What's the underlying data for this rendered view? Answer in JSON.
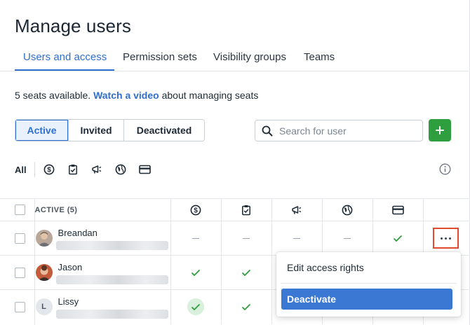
{
  "page": {
    "title": "Manage users"
  },
  "tabs": [
    {
      "label": "Users and access",
      "active": true
    },
    {
      "label": "Permission sets",
      "active": false
    },
    {
      "label": "Visibility groups",
      "active": false
    },
    {
      "label": "Teams",
      "active": false
    }
  ],
  "seats": {
    "prefix": "5 seats available.",
    "link": "Watch a video",
    "suffix": "about managing seats"
  },
  "segments": [
    {
      "label": "Active",
      "active": true
    },
    {
      "label": "Invited",
      "active": false
    },
    {
      "label": "Deactivated",
      "active": false
    }
  ],
  "search": {
    "placeholder": "Search for user"
  },
  "add_button": {
    "icon": "plus-icon"
  },
  "filters": {
    "all_label": "All",
    "icons": [
      "dollar-circle-icon",
      "clipboard-check-icon",
      "megaphone-icon",
      "globe-icon",
      "credit-card-icon"
    ]
  },
  "table": {
    "header_label": "ACTIVE (5)",
    "columns": [
      "dollar-circle-icon",
      "clipboard-check-icon",
      "megaphone-icon",
      "globe-icon",
      "credit-card-icon"
    ],
    "rows": [
      {
        "name": "Breandan",
        "avatar": "photo",
        "perms": [
          "dash",
          "dash",
          "dash",
          "dash",
          "check"
        ]
      },
      {
        "name": "Jason",
        "avatar": "photo",
        "perms": [
          "check",
          "check",
          "",
          "",
          ""
        ]
      },
      {
        "name": "Lissy",
        "avatar": "L",
        "perms": [
          "check-highlight",
          "check",
          "",
          "",
          ""
        ]
      }
    ]
  },
  "menu": {
    "edit_label": "Edit access rights",
    "deactivate_label": "Deactivate"
  },
  "colors": {
    "accent": "#2f6fd0",
    "success": "#2f9e3f",
    "highlight": "#e24a2e",
    "menu_active": "#3a78d4"
  }
}
